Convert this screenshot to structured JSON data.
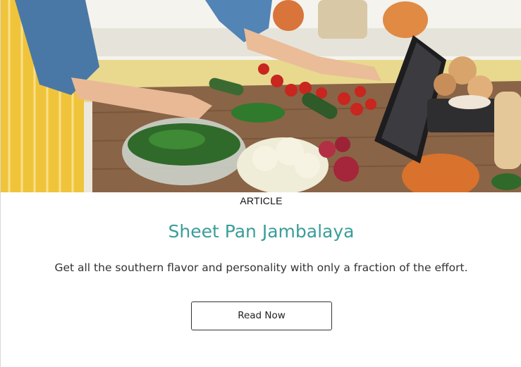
{
  "card": {
    "eyebrow": "ARTICLE",
    "title": "Sheet Pan Jambalaya",
    "description": "Get all the southern flavor and personality with only a fraction of the effort.",
    "cta_label": "Read Now"
  },
  "colors": {
    "title": "#3a9d9a",
    "text": "#333333",
    "button_border": "#333333"
  }
}
